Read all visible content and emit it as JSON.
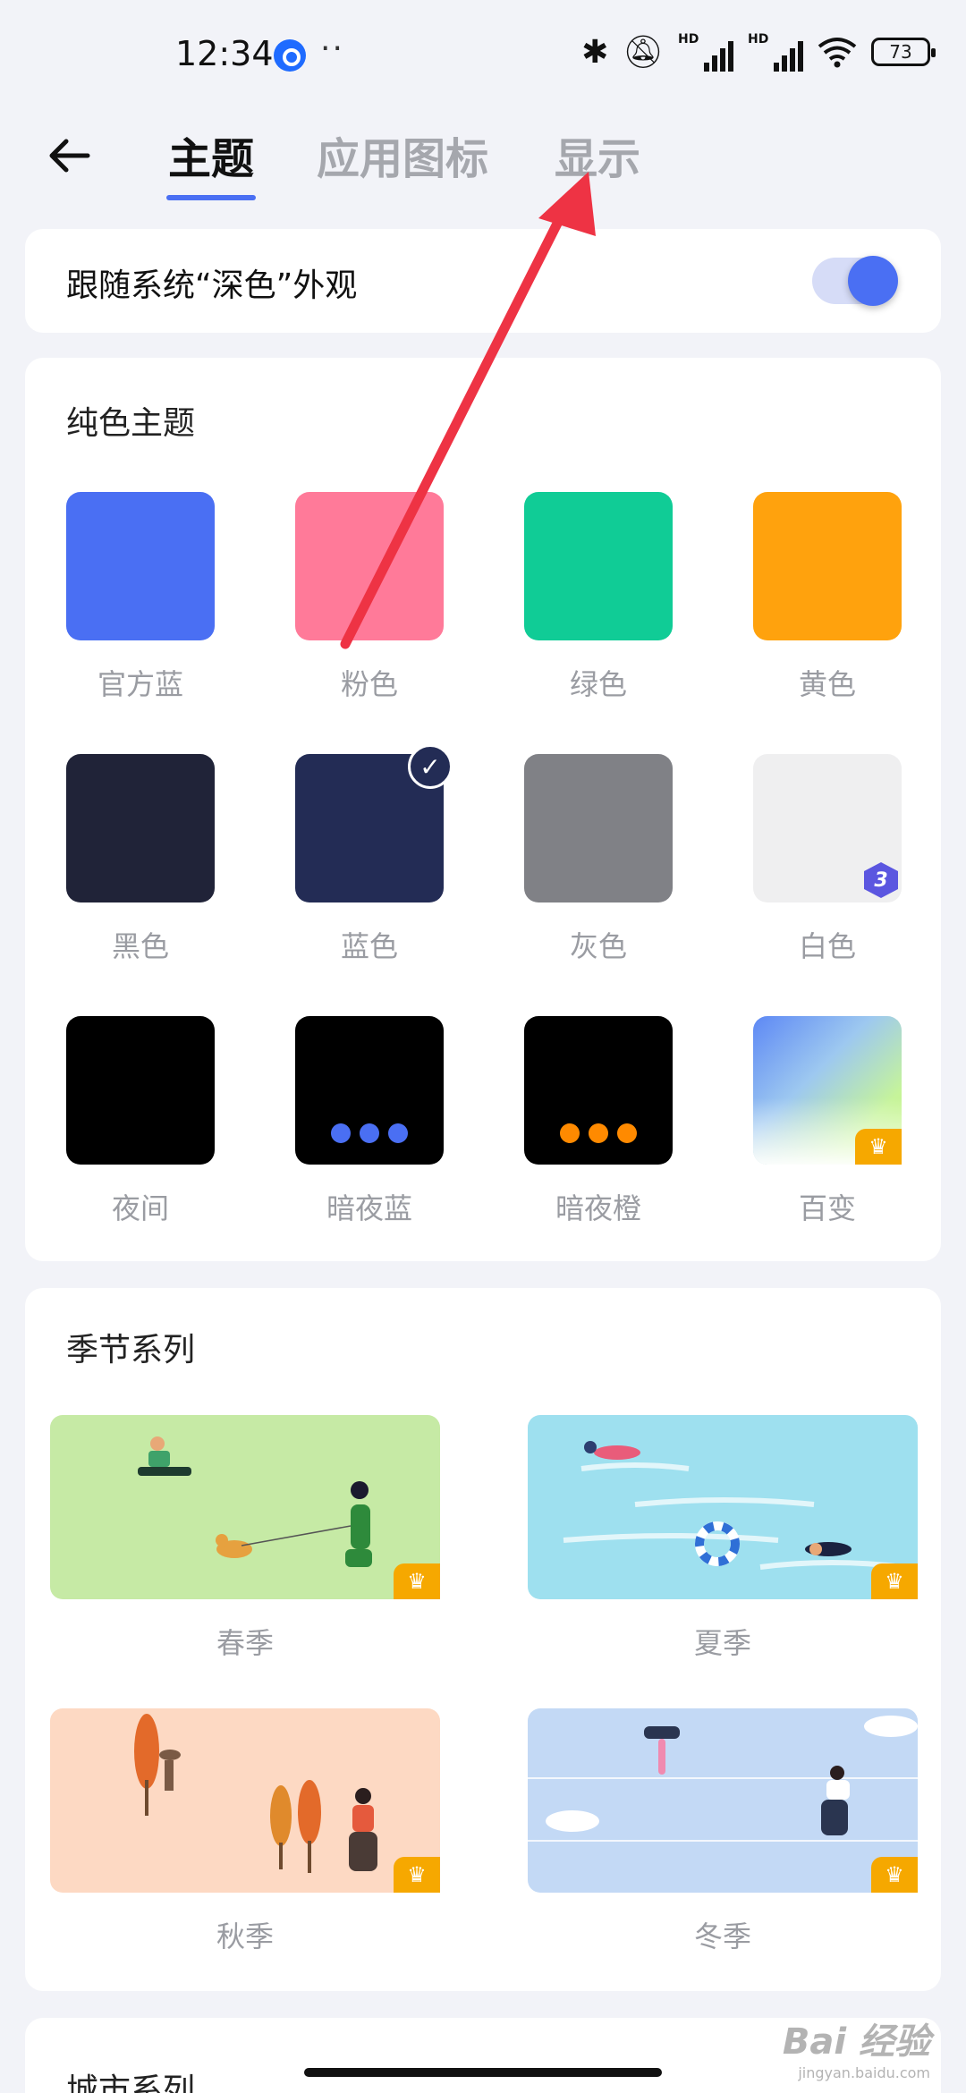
{
  "status_bar": {
    "time": "12:34",
    "more": "··",
    "hd1": "HD",
    "hd2": "HD",
    "battery": "73"
  },
  "header": {
    "tabs": [
      {
        "label": "主题",
        "active": true
      },
      {
        "label": "应用图标",
        "active": false
      },
      {
        "label": "显示",
        "active": false
      }
    ]
  },
  "dark_mode": {
    "label": "跟随系统“深色”外观",
    "enabled": true
  },
  "solid_themes": {
    "title": "纯色主题",
    "items": [
      {
        "label": "官方蓝",
        "color": "#4A6FF3"
      },
      {
        "label": "粉色",
        "color": "#FF7A99"
      },
      {
        "label": "绿色",
        "color": "#10CC96"
      },
      {
        "label": "黄色",
        "color": "#FFA20D"
      },
      {
        "label": "黑色",
        "color": "#202338"
      },
      {
        "label": "蓝色",
        "color": "#232C55",
        "selected": true
      },
      {
        "label": "灰色",
        "color": "#808186"
      },
      {
        "label": "白色",
        "color": "#EFEFF0",
        "badge": "3"
      },
      {
        "label": "夜间",
        "color": "#000000"
      },
      {
        "label": "暗夜蓝",
        "color": "#000000",
        "dots_color": "#4A6FF3"
      },
      {
        "label": "暗夜橙",
        "color": "#000000",
        "dots_color": "#FF8A00"
      },
      {
        "label": "百变",
        "color": "gradient",
        "premium": true
      }
    ]
  },
  "season_series": {
    "title": "季节系列",
    "items": [
      {
        "label": "春季",
        "color": "#C6EAA5",
        "premium": true
      },
      {
        "label": "夏季",
        "color": "#9EE0EF",
        "premium": true
      },
      {
        "label": "秋季",
        "color": "#FDD9C3",
        "premium": true
      },
      {
        "label": "冬季",
        "color": "#C3D9F5",
        "premium": true
      }
    ]
  },
  "city_series": {
    "title": "城市系列"
  },
  "watermark": {
    "brand": "Bai 经验",
    "url": "jingyan.baidu.com"
  }
}
